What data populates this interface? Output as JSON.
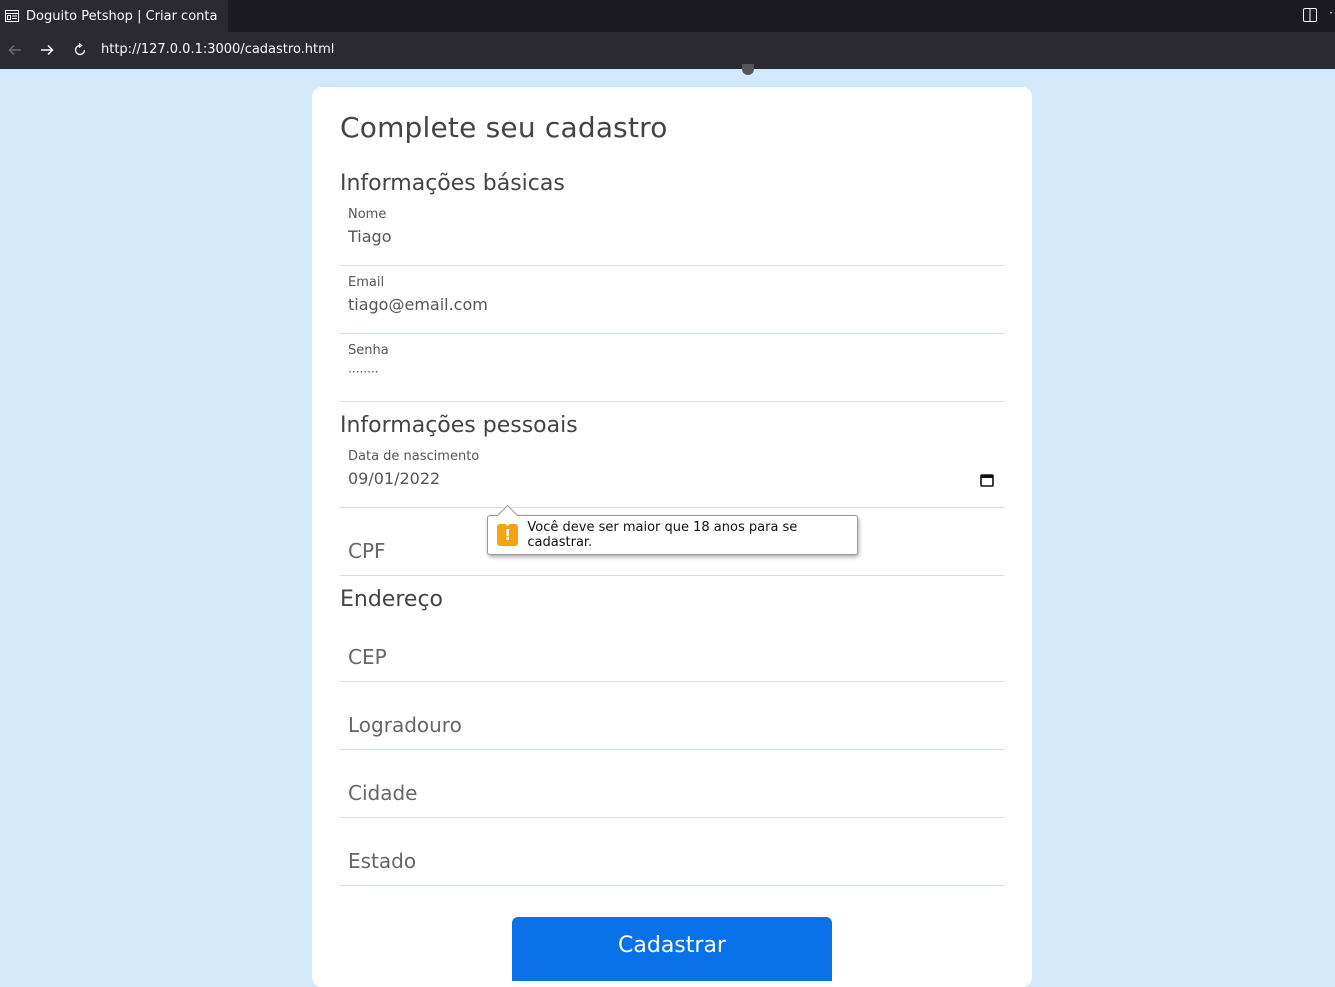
{
  "browser": {
    "tab_title": "Doguito Petshop | Criar conta",
    "url": "http://127.0.0.1:3000/cadastro.html",
    "tab_overflow": "·"
  },
  "form": {
    "title": "Complete seu cadastro",
    "sections": {
      "basic": "Informações básicas",
      "personal": "Informações pessoais",
      "address": "Endereço"
    },
    "nome": {
      "label": "Nome",
      "value": "Tiago"
    },
    "email": {
      "label": "Email",
      "value": "tiago@email.com"
    },
    "senha": {
      "label": "Senha",
      "value": "········"
    },
    "nascimento": {
      "label": "Data de nascimento",
      "value": "09/01/2022"
    },
    "cpf": {
      "placeholder": "CPF"
    },
    "cep": {
      "placeholder": "CEP"
    },
    "logradouro": {
      "placeholder": "Logradouro"
    },
    "cidade": {
      "placeholder": "Cidade"
    },
    "estado": {
      "placeholder": "Estado"
    },
    "submit_label": "Cadastrar"
  },
  "validation": {
    "message": "Você deve ser maior que 18 anos para se cadastrar.",
    "icon": "!"
  },
  "colors": {
    "page_bg": "#d4e8fc",
    "button": "#0a72e8",
    "warning": "#f5a312"
  }
}
